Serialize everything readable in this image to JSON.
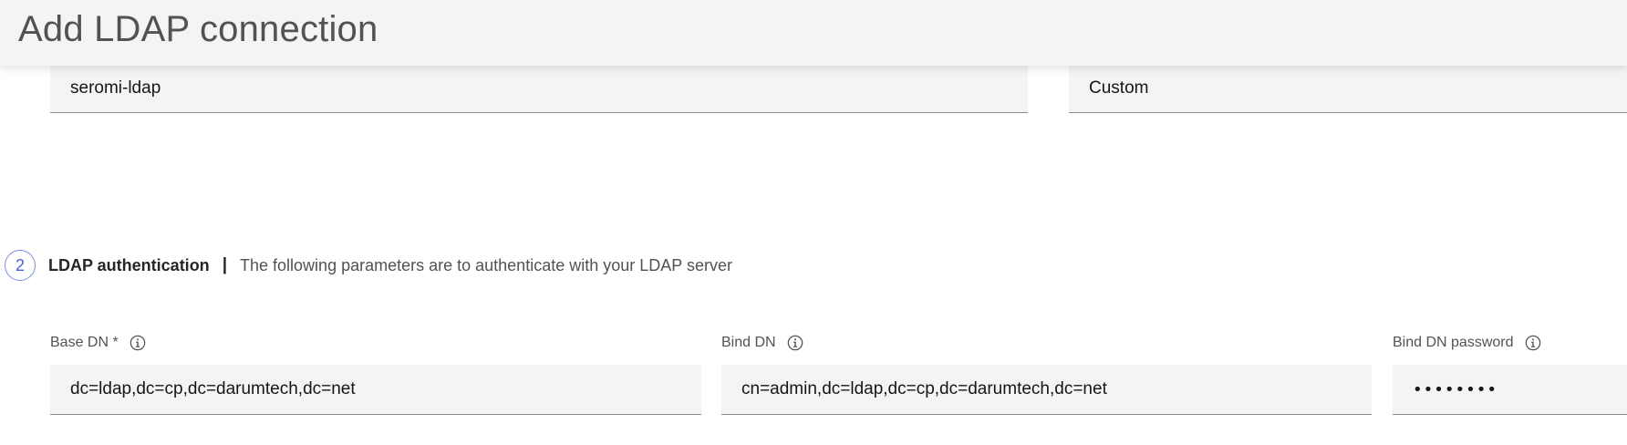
{
  "modal": {
    "title": "Add LDAP connection"
  },
  "connection": {
    "name_value": "seromi-ldap",
    "type_value": "Custom"
  },
  "ldap_auth": {
    "step_number": "2",
    "title": "LDAP authentication",
    "separator": "|",
    "description": "The following parameters are to authenticate with your LDAP server",
    "base_dn": {
      "label": "Base DN *",
      "value": "dc=ldap,dc=cp,dc=darumtech,dc=net"
    },
    "bind_dn": {
      "label": "Bind DN",
      "value": "cn=admin,dc=ldap,dc=cp,dc=darumtech,dc=net"
    },
    "bind_dn_password": {
      "label": "Bind DN password",
      "value": "••••••••"
    }
  },
  "icons": {
    "info": "info-icon"
  },
  "colors": {
    "step_accent": "#4a5fd6",
    "field_background": "#f4f4f4",
    "field_border": "#8d8d8d"
  }
}
